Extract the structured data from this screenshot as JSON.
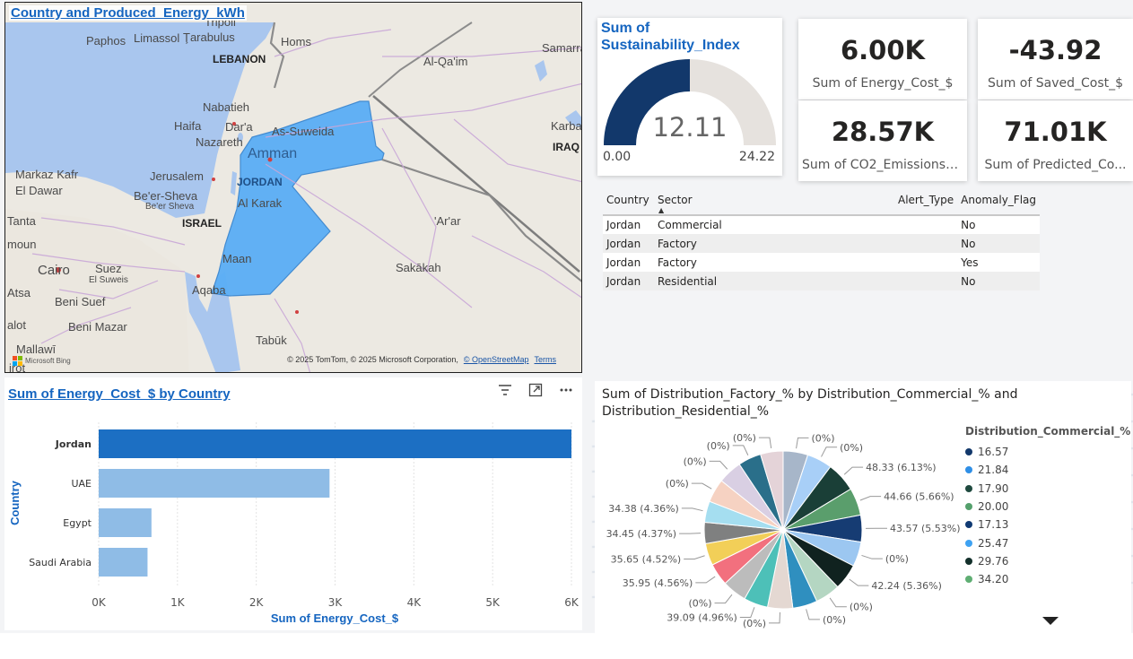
{
  "map": {
    "title": "Country and Produced_Energy_kWh",
    "labels": [
      {
        "id": "paphos",
        "text": "Paphos"
      },
      {
        "id": "limassol",
        "text": "Limassol"
      },
      {
        "id": "tarabulus",
        "text": "Ţarabulus"
      },
      {
        "id": "tripoli",
        "text": "Tripoli"
      },
      {
        "id": "homs",
        "text": "Homs"
      },
      {
        "id": "lebanon",
        "text": "LEBANON",
        "kind": "country"
      },
      {
        "id": "alqaim",
        "text": "Al-Qa'im"
      },
      {
        "id": "samarra",
        "text": "Samarra"
      },
      {
        "id": "nabatieh",
        "text": "Nabatieh"
      },
      {
        "id": "haifa",
        "text": "Haifa"
      },
      {
        "id": "dara",
        "text": "Dar'a"
      },
      {
        "id": "nazareth",
        "text": "Nazareth"
      },
      {
        "id": "assuweida",
        "text": "As-Suweida"
      },
      {
        "id": "karbala",
        "text": "Karbala"
      },
      {
        "id": "iraq",
        "text": "IRAQ",
        "kind": "country"
      },
      {
        "id": "amman",
        "text": "Amman",
        "kind": "capital"
      },
      {
        "id": "markaz",
        "text": "Markaz Kafr"
      },
      {
        "id": "eldawar",
        "text": "El Dawar"
      },
      {
        "id": "jerusalem",
        "text": "Jerusalem"
      },
      {
        "id": "jordan",
        "text": "JORDAN",
        "kind": "jordan"
      },
      {
        "id": "beersheva",
        "text": "Be'er-Sheva"
      },
      {
        "id": "beersheva2",
        "text": "Be'er Sheva",
        "kind": "small"
      },
      {
        "id": "alkarak",
        "text": "Al Karak"
      },
      {
        "id": "tanta",
        "text": "Tanta"
      },
      {
        "id": "israel",
        "text": "ISRAEL",
        "kind": "country"
      },
      {
        "id": "arar",
        "text": "'Ar'ar"
      },
      {
        "id": "moun",
        "text": "moun"
      },
      {
        "id": "cairo",
        "text": "Cairo",
        "kind": "city"
      },
      {
        "id": "suez",
        "text": "Suez"
      },
      {
        "id": "elsuweis",
        "text": "El Suweis",
        "kind": "small"
      },
      {
        "id": "sakakah",
        "text": "Sakākah"
      },
      {
        "id": "maan",
        "text": "Maan"
      },
      {
        "id": "atsa",
        "text": "Atsa"
      },
      {
        "id": "benisuef",
        "text": "Beni Suef"
      },
      {
        "id": "aqaba",
        "text": "Aqaba"
      },
      {
        "id": "alot",
        "text": "alot"
      },
      {
        "id": "benimazar",
        "text": "Beni Mazar"
      },
      {
        "id": "tabuk",
        "text": "Tabūk"
      },
      {
        "id": "mallawi",
        "text": "Mallawī"
      },
      {
        "id": "irot",
        "text": "irot"
      }
    ],
    "bing": "Microsoft Bing",
    "credits": "© 2025 TomTom, © 2025 Microsoft Corporation,",
    "osm": "© OpenStreetMap",
    "terms": "Terms"
  },
  "gauge": {
    "title": "Sum of Sustainability_Index",
    "value": 12.11,
    "value_text": "12.11",
    "min": 0,
    "min_text": "0.00",
    "max": 24.22,
    "max_text": "24.22",
    "fill_color": "#12386b",
    "track_color": "#e6e2de"
  },
  "kpis": {
    "energy": {
      "value": "6.00K",
      "label": "Sum of Energy_Cost_$"
    },
    "saved": {
      "value": "-43.92",
      "label": "Sum of Saved_Cost_$"
    },
    "co2": {
      "value": "28.57K",
      "label": "Sum of CO2_Emissions_..."
    },
    "predicted": {
      "value": "71.01K",
      "label": "Sum of Predicted_Co..."
    }
  },
  "table": {
    "columns": [
      "Country",
      "Sector",
      "Alert_Type",
      "Anomaly_Flag"
    ],
    "rows": [
      [
        "Jordan",
        "Commercial",
        "",
        "No"
      ],
      [
        "Jordan",
        "Factory",
        "",
        "No"
      ],
      [
        "Jordan",
        "Factory",
        "",
        "Yes"
      ],
      [
        "Jordan",
        "Residential",
        "",
        "No"
      ]
    ]
  },
  "bar_visual": {
    "title": "Sum of Energy_Cost_$ by Country",
    "icons": [
      "filter-icon",
      "focus-mode-icon",
      "more-options-icon"
    ]
  },
  "pie_visual": {
    "title": "Sum of Distribution_Factory_% by Distribution_Commercial_% and Distribution_Residential_%",
    "legend_title": "Distribution_Commercial_%"
  },
  "chart_data": [
    {
      "type": "bar",
      "orientation": "horizontal",
      "title": "Sum of Energy_Cost_$ by Country",
      "xlabel": "Sum of Energy_Cost_$",
      "ylabel": "Country",
      "categories": [
        "Jordan",
        "UAE",
        "Egypt",
        "Saudi Arabia"
      ],
      "values": [
        6000,
        2930,
        670,
        620
      ],
      "xlim": [
        0,
        6000
      ],
      "xticks": [
        "0K",
        "1K",
        "2K",
        "3K",
        "4K",
        "5K",
        "6K"
      ],
      "colors": [
        "#1c6fc3",
        "#8fbce6",
        "#8fbce6",
        "#8fbce6"
      ],
      "grid": true
    },
    {
      "type": "pie",
      "title": "Sum of Distribution_Factory_% by Distribution_Commercial_% and Distribution_Residential_%",
      "legend_title": "Distribution_Commercial_%",
      "legend_position": "right",
      "legend": [
        {
          "label": "16.57",
          "color": "#12386b"
        },
        {
          "label": "21.84",
          "color": "#2f8fe6"
        },
        {
          "label": "17.90",
          "color": "#1f4a3f"
        },
        {
          "label": "20.00",
          "color": "#54a06c"
        },
        {
          "label": "17.13",
          "color": "#103a73"
        },
        {
          "label": "25.47",
          "color": "#3ea2f2"
        },
        {
          "label": "29.76",
          "color": "#13302b"
        },
        {
          "label": "34.20",
          "color": "#5fae73"
        }
      ],
      "slices": [
        {
          "value": 40.1,
          "label": "(0%)",
          "color": "#a7b6c9"
        },
        {
          "value": 40.9,
          "label": "(0%)",
          "color": "#a8cff7"
        },
        {
          "value": 48.33,
          "label": "48.33 (6.13%)",
          "color": "#1a3f37"
        },
        {
          "value": 44.66,
          "label": "44.66 (5.66%)",
          "color": "#5a9e6c"
        },
        {
          "value": 43.57,
          "label": "43.57 (5.53%)",
          "color": "#163c73"
        },
        {
          "value": 40.0,
          "label": "(0%)",
          "color": "#9cc7f1"
        },
        {
          "value": 42.24,
          "label": "42.24 (5.36%)",
          "color": "#10221f"
        },
        {
          "value": 40.5,
          "label": "(0%)",
          "color": "#b4d6c2"
        },
        {
          "value": 40.0,
          "label": "(0%)",
          "color": "#2f8fbf"
        },
        {
          "value": 40.8,
          "label": "(0%)",
          "color": "#e4d8d2"
        },
        {
          "value": 39.09,
          "label": "39.09 (4.96%)",
          "color": "#4dc0b8"
        },
        {
          "value": 39.8,
          "label": "(0%)",
          "color": "#bcbcbc"
        },
        {
          "value": 35.95,
          "label": "35.95 (4.56%)",
          "color": "#f2707e"
        },
        {
          "value": 35.65,
          "label": "35.65 (4.52%)",
          "color": "#f2cf58"
        },
        {
          "value": 34.45,
          "label": "34.45 (4.37%)",
          "color": "#7f8080"
        },
        {
          "value": 34.38,
          "label": "34.38 (4.36%)",
          "color": "#a5def0"
        },
        {
          "value": 38.2,
          "label": "(0%)",
          "color": "#f6d2c2"
        },
        {
          "value": 39.0,
          "label": "(0%)",
          "color": "#d9cfe3"
        },
        {
          "value": 37.4,
          "label": "(0%)",
          "color": "#2a6f8a"
        },
        {
          "value": 36.7,
          "label": "(0%)",
          "color": "#e4d3d8"
        }
      ]
    }
  ]
}
